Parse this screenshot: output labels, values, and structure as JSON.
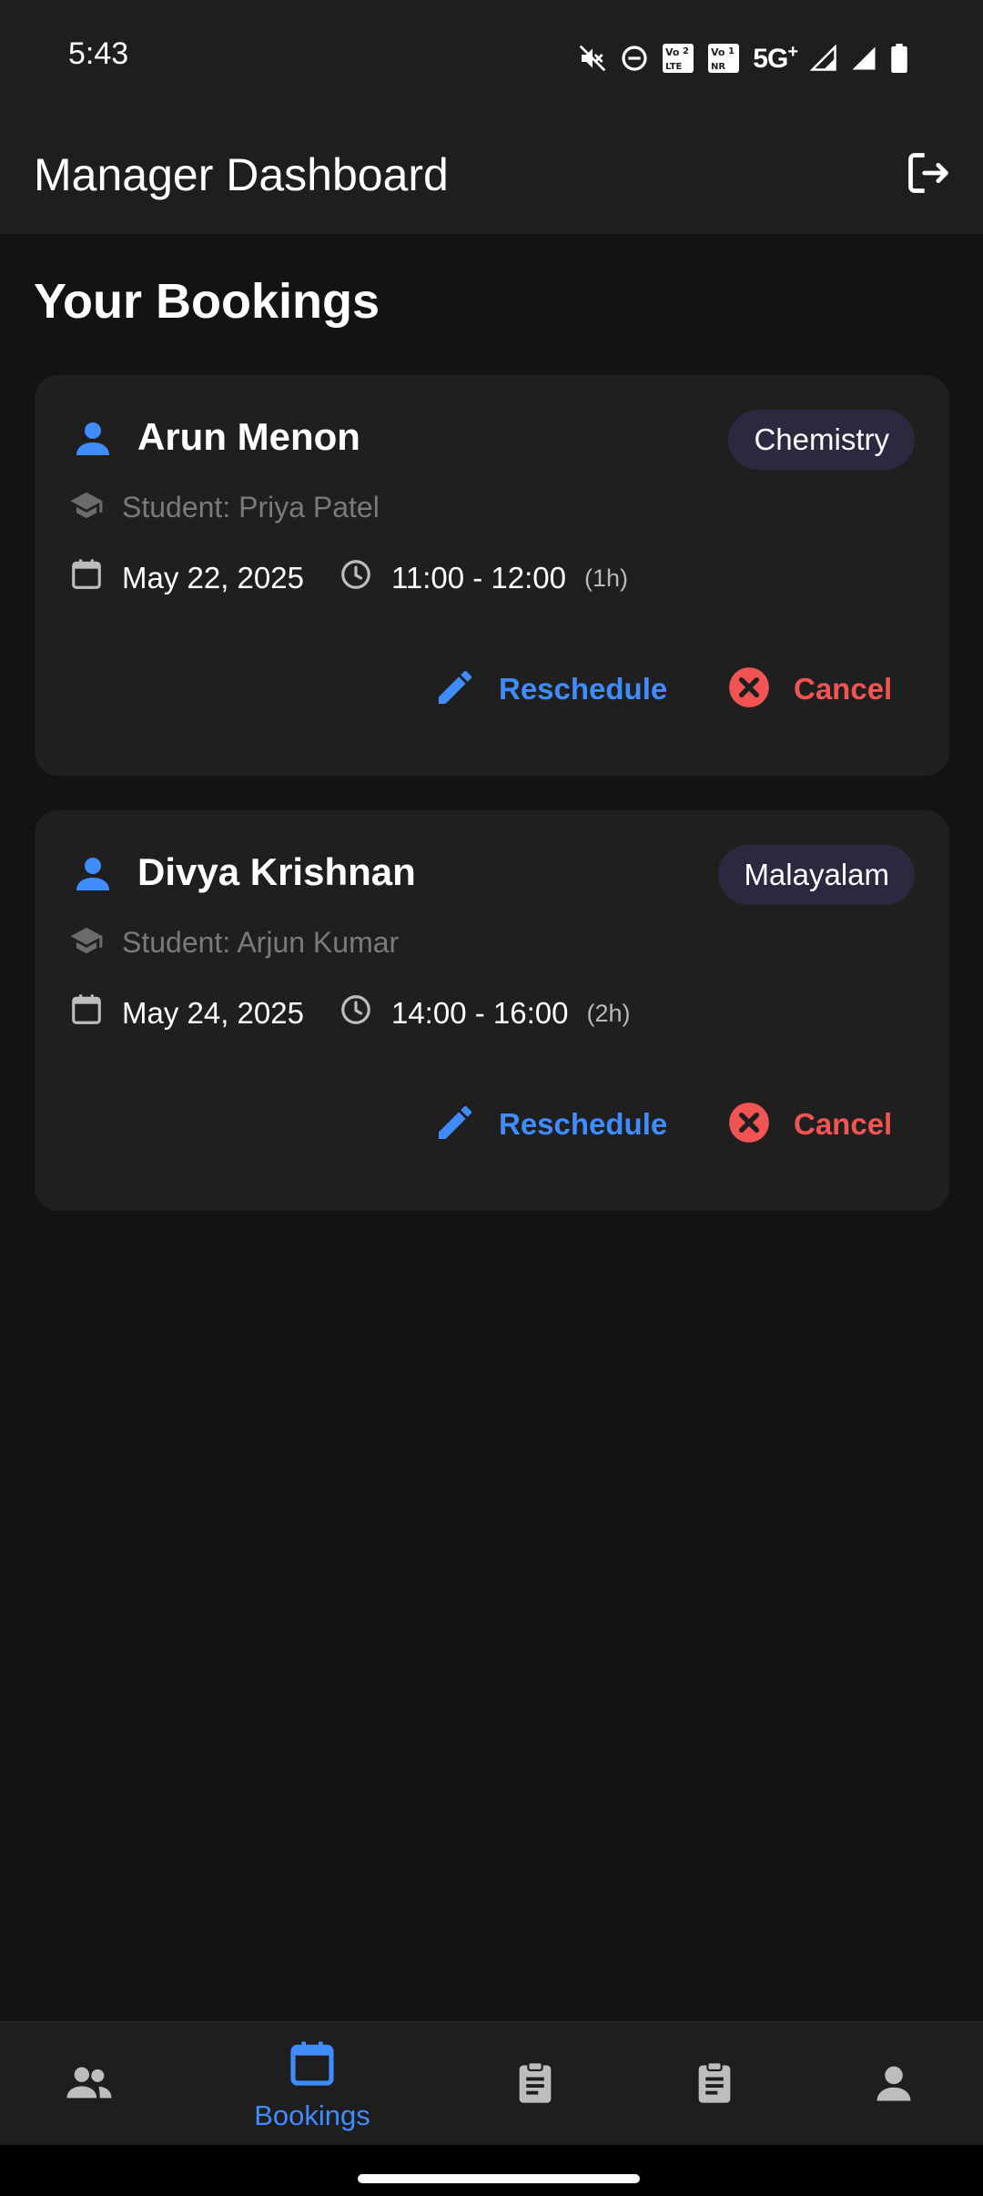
{
  "status_bar": {
    "time": "5:43",
    "network": "5G",
    "network_sup": "+",
    "icons": [
      "mute-icon",
      "dnd-icon",
      "volte-2-icon",
      "vonr-1-icon",
      "signal-icon",
      "signal-icon",
      "battery-icon"
    ]
  },
  "app_bar": {
    "title": "Manager Dashboard",
    "action_icon": "logout-icon"
  },
  "main": {
    "section_title": "Your Bookings",
    "bookings": [
      {
        "tutor": "Arun Menon",
        "subject": "Chemistry",
        "student": "Student: Priya Patel",
        "date": "May 22, 2025",
        "time": "11:00 - 12:00",
        "duration": "(1h)",
        "reschedule_label": "Reschedule",
        "cancel_label": "Cancel"
      },
      {
        "tutor": "Divya Krishnan",
        "subject": "Malayalam",
        "student": "Student: Arjun Kumar",
        "date": "May 24, 2025",
        "time": "14:00 - 16:00",
        "duration": "(2h)",
        "reschedule_label": "Reschedule",
        "cancel_label": "Cancel"
      }
    ]
  },
  "bottom_nav": {
    "items": [
      {
        "icon": "people-icon",
        "label": ""
      },
      {
        "icon": "calendar-icon",
        "label": "Bookings",
        "active": true
      },
      {
        "icon": "clipboard-icon",
        "label": ""
      },
      {
        "icon": "clipboard-icon",
        "label": ""
      },
      {
        "icon": "person-icon",
        "label": ""
      }
    ]
  },
  "colors": {
    "background": "#131313",
    "surface": "#1f1f1f",
    "accent": "#3f8cff",
    "danger": "#f25454",
    "badge": "#2e2740",
    "muted_text": "#7a7a7a"
  }
}
